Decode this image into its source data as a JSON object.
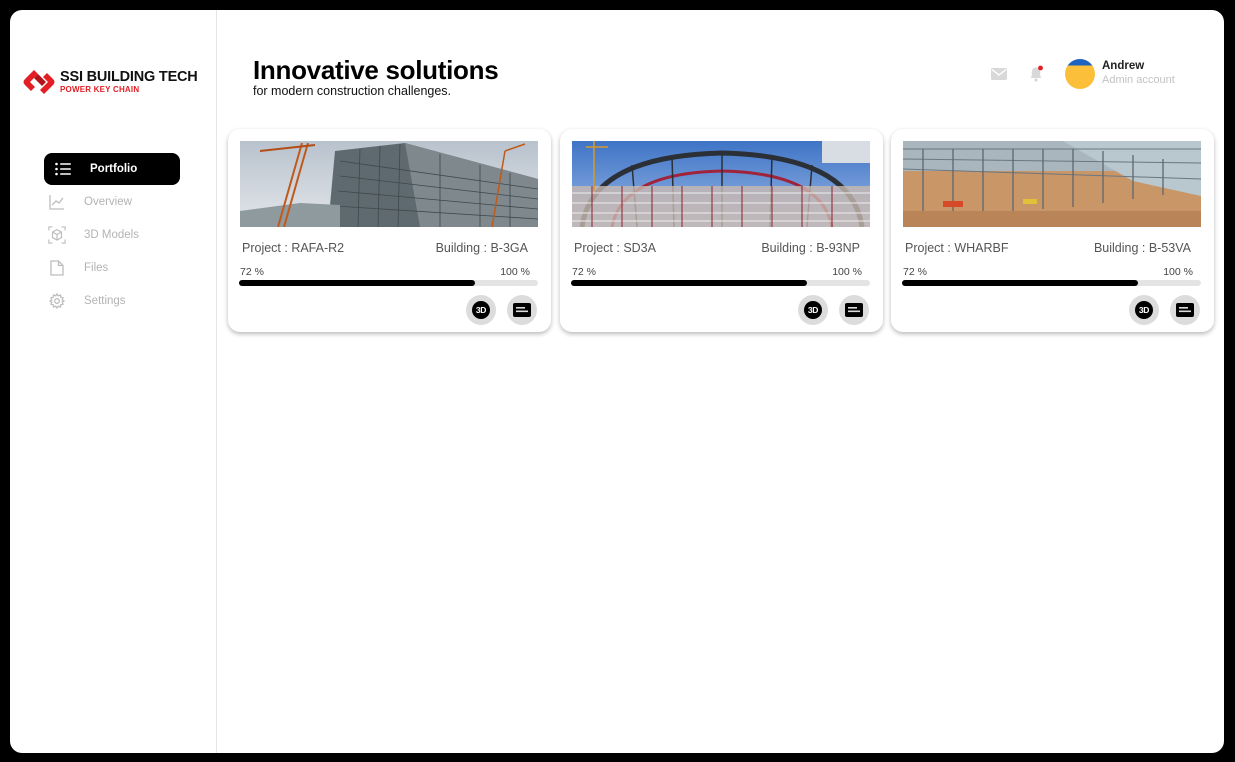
{
  "brand": {
    "title": "SSI BUILDING TECH",
    "subtitle": "POWER KEY CHAIN",
    "accent": "#e31e24"
  },
  "sidebar": {
    "items": [
      {
        "label": "Portfolio",
        "icon": "list-icon",
        "active": true
      },
      {
        "label": "Overview",
        "icon": "chart-icon",
        "active": false
      },
      {
        "label": "3D Models",
        "icon": "cube-icon",
        "active": false
      },
      {
        "label": "Files",
        "icon": "file-icon",
        "active": false
      },
      {
        "label": "Settings",
        "icon": "gear-icon",
        "active": false
      }
    ]
  },
  "header": {
    "title": "Innovative solutions",
    "subtitle": "for modern construction challenges."
  },
  "user": {
    "name": "Andrew",
    "role": "Admin account"
  },
  "notifications": {
    "has_unread": true,
    "dot_color": "#e31e24"
  },
  "projects": [
    {
      "project": "Project : RAFA-R2",
      "building": "Building : B-3GA",
      "progress_label": "72 %",
      "total_label": "100 %",
      "progress": 0.79,
      "three_d_label": "3D",
      "image": "construction-facade-photo"
    },
    {
      "project": "Project : SD3A",
      "building": "Building : B-93NP",
      "progress_label": "72 %",
      "total_label": "100 %",
      "progress": 0.79,
      "three_d_label": "3D",
      "image": "steel-dome-scaffold-photo"
    },
    {
      "project": "Project : WHARBF",
      "building": "Building : B-53VA",
      "progress_label": "72 %",
      "total_label": "100 %",
      "progress": 0.79,
      "three_d_label": "3D",
      "image": "steel-frame-site-photo"
    }
  ]
}
